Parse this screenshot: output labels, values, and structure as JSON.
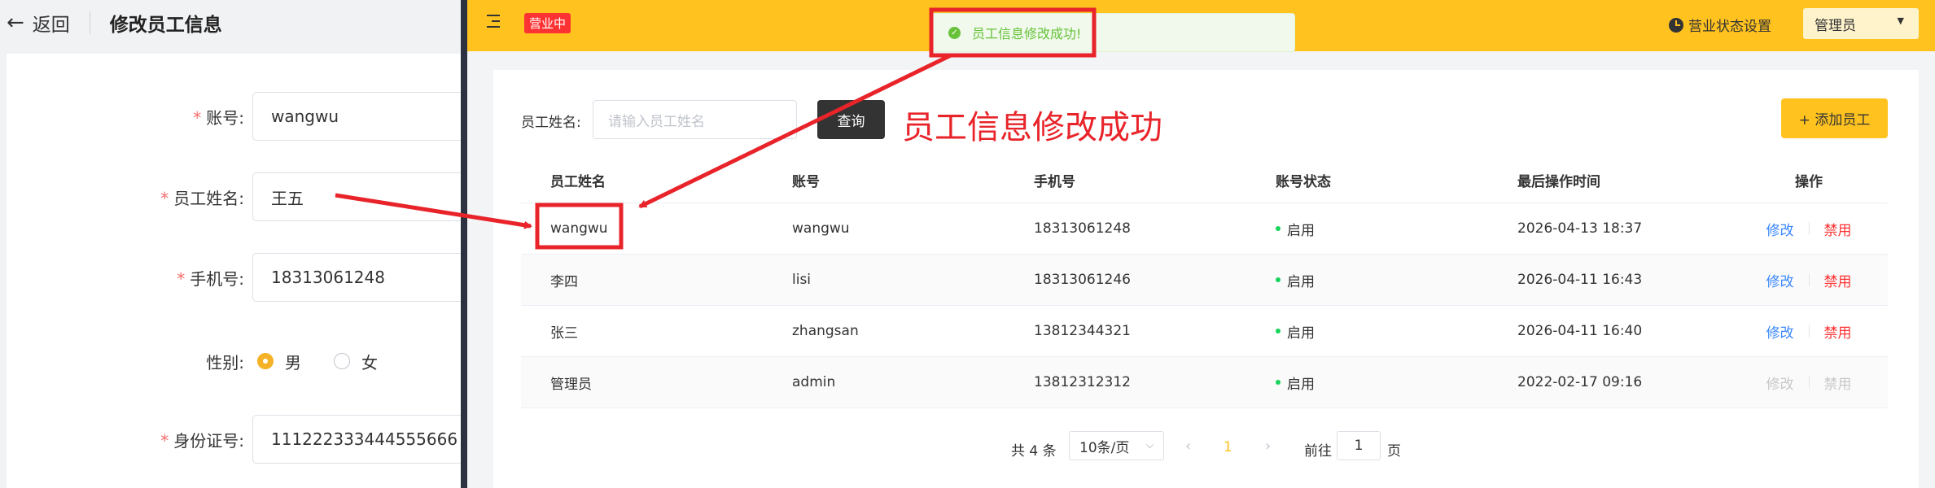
{
  "edit_page": {
    "back_label": "返回",
    "title": "修改员工信息",
    "fields": {
      "account": {
        "label": "账号:",
        "value": "wangwu",
        "required": true
      },
      "name": {
        "label": "员工姓名:",
        "value": "王五",
        "required": true
      },
      "phone": {
        "label": "手机号:",
        "value": "18313061248",
        "required": true
      },
      "gender": {
        "label": "性别:",
        "options": [
          "男",
          "女"
        ],
        "selected": "男",
        "required": false
      },
      "id_card": {
        "label": "身份证号:",
        "value": "111222333444555666",
        "required": true
      }
    },
    "required_mark": "*"
  },
  "topbar": {
    "status_tag": "营业中",
    "toast": "员工信息修改成功!",
    "biz_settings_label": "营业状态设置",
    "user_menu": "管理员"
  },
  "toolbar": {
    "search_label": "员工姓名:",
    "search_placeholder": "请输入员工姓名",
    "query_button": "查询",
    "add_button": "+ 添加员工"
  },
  "annotation_text": "员工信息修改成功",
  "table": {
    "headers": [
      "员工姓名",
      "账号",
      "手机号",
      "账号状态",
      "最后操作时间",
      "操作"
    ],
    "rows": [
      {
        "name": "wangwu",
        "account": "wangwu",
        "phone": "18313061248",
        "status": "启用",
        "time": "2026-04-13 18:37",
        "edit": "修改",
        "ban": "禁用",
        "actions_enabled": true
      },
      {
        "name": "李四",
        "account": "lisi",
        "phone": "18313061246",
        "status": "启用",
        "time": "2026-04-11 16:43",
        "edit": "修改",
        "ban": "禁用",
        "actions_enabled": true
      },
      {
        "name": "张三",
        "account": "zhangsan",
        "phone": "13812344321",
        "status": "启用",
        "time": "2026-04-11 16:40",
        "edit": "修改",
        "ban": "禁用",
        "actions_enabled": true
      },
      {
        "name": "管理员",
        "account": "admin",
        "phone": "13812312312",
        "status": "启用",
        "time": "2022-02-17 09:16",
        "edit": "修改",
        "ban": "禁用",
        "actions_enabled": false
      }
    ]
  },
  "pagination": {
    "total": "共 4 条",
    "page_size": "10条/页",
    "current_page": "1",
    "goto_label": "前往",
    "goto_value": "1",
    "page_suffix": "页"
  },
  "colors": {
    "brand": "#ffc21f",
    "annotation": "#e8242a",
    "link": "#3b88ff",
    "danger": "#fd3333",
    "status_dot": "#16d45a",
    "toast_text": "#67c23a"
  }
}
